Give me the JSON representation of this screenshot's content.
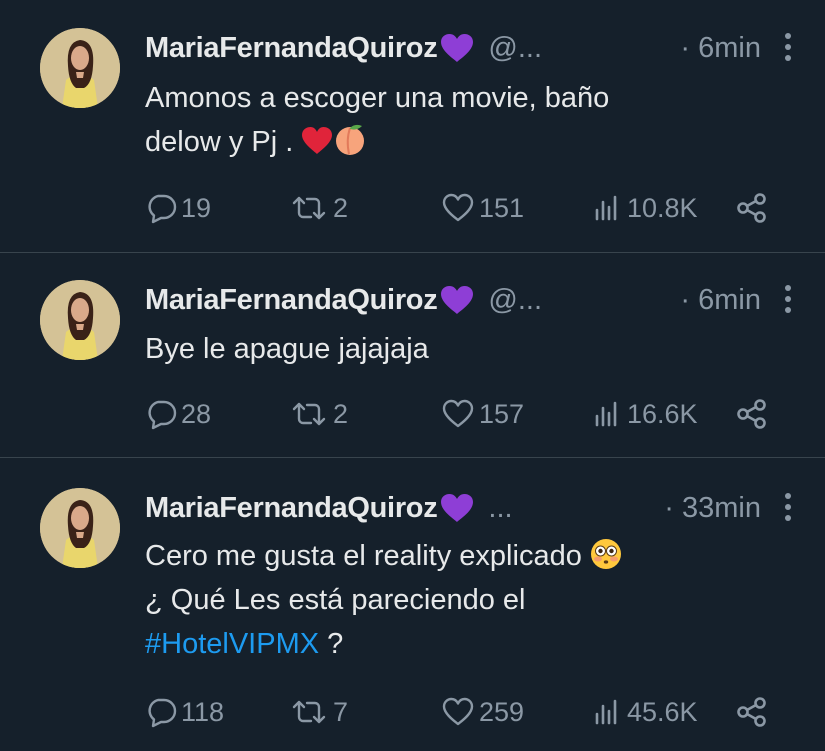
{
  "tweets": [
    {
      "name": "MariaFernandaQuiroz",
      "name_emoji": "💜",
      "handle": "@...",
      "time": "· 6min",
      "lines": [
        "Amonos a escoger una movie, baño",
        "delow y Pj ."
      ],
      "line_emojis": [
        "❤️",
        "🍑"
      ],
      "replies": "19",
      "retweets": "2",
      "likes": "151",
      "views": "10.8K"
    },
    {
      "name": "MariaFernandaQuiroz",
      "name_emoji": "💜",
      "handle": "@...",
      "time": "· 6min",
      "lines": [
        "Bye le apague jajajaja"
      ],
      "replies": "28",
      "retweets": "2",
      "likes": "157",
      "views": "16.6K"
    },
    {
      "name": "MariaFernandaQuiroz",
      "name_emoji": "💜",
      "handle": "...",
      "time": "· 33min",
      "lines": [
        "Cero me gusta el reality explicado",
        "¿ Qué Les está pareciendo el"
      ],
      "line_emojis": [
        "😳"
      ],
      "hashtag": "#HotelVIPMX",
      "hashtag_suffix": " ?",
      "replies": "118",
      "retweets": "7",
      "likes": "259",
      "views": "45.6K"
    }
  ],
  "icons": {
    "reply": "speech-bubble-icon",
    "retweet": "retweet-arrows-icon",
    "like": "heart-outline-icon",
    "views": "bar-chart-icon",
    "share": "share-nodes-icon",
    "more": "three-dots-vertical-icon"
  },
  "colors": {
    "background": "#15202b",
    "text": "#e7e9ea",
    "muted": "#8b98a5",
    "link": "#1d9bf0",
    "divider": "#38444d",
    "purple_heart": "#8e3ed6"
  }
}
